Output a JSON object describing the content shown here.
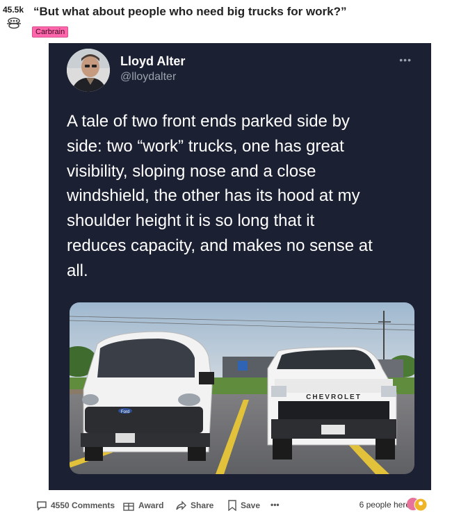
{
  "vote": {
    "count": "45.5k"
  },
  "post": {
    "title": "“But what about people who need big trucks for work?”",
    "flair": "Carbrain"
  },
  "tweet": {
    "author_name": "Lloyd Alter",
    "author_handle": "@lloydalter",
    "more_icon": "•••",
    "text": "A tale of two front ends parked side by\nside: two “work” trucks, one has great\nvisibility, sloping nose and a close\nwindshield, the other has its hood at my\nshoulder height it is so long that it\nreduces capacity, and makes no sense at\nall.",
    "photo": {
      "van_badge": "Ford",
      "truck_brand": "CHEVROLET"
    }
  },
  "footer": {
    "comments_label": "4550 Comments",
    "award_label": "Award",
    "share_label": "Share",
    "save_label": "Save",
    "more_label": "•••",
    "presence_label": "6 people here"
  },
  "colors": {
    "tweet_bg": "#1c2033",
    "flair_bg": "#ff66ac",
    "handle_gray": "#9aa3ad"
  },
  "icons": [
    "award-icon",
    "more-icon",
    "comment-icon",
    "gift-icon",
    "share-icon",
    "bookmark-icon",
    "avatar"
  ]
}
